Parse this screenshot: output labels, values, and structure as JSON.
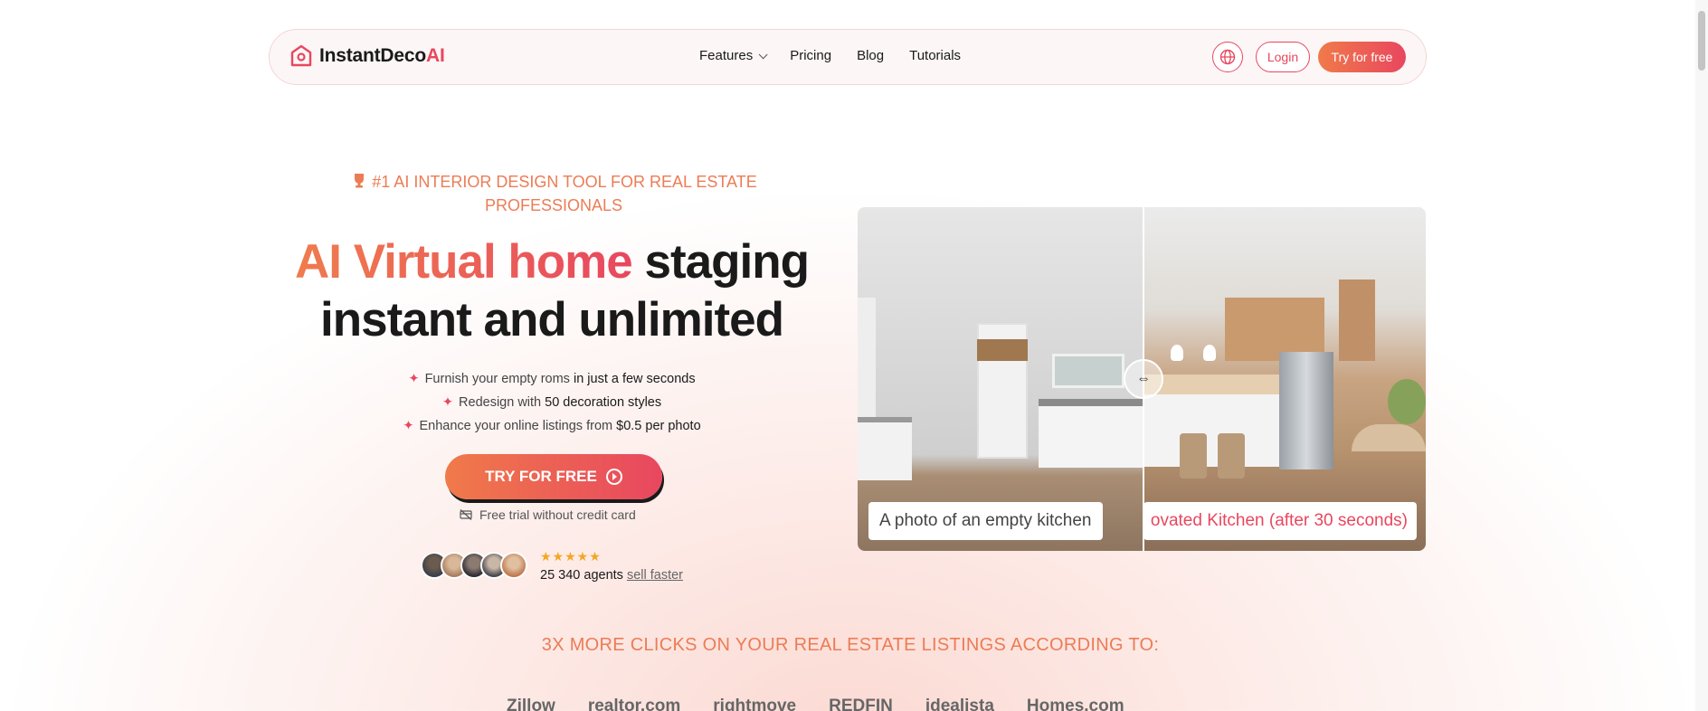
{
  "nav": {
    "brand_main": "InstantDeco",
    "brand_ai": "AI",
    "menu": [
      "Features",
      "Pricing",
      "Blog",
      "Tutorials"
    ],
    "login": "Login",
    "try_free": "Try for free"
  },
  "hero": {
    "tagline": "#1 AI INTERIOR DESIGN TOOL FOR REAL ESTATE PROFESSIONALS",
    "headline_accent": "AI Virtual home",
    "headline_rest_1": " staging",
    "headline_rest_2": "instant and unlimited",
    "bullets": [
      {
        "plain": "Furnish your empty roms ",
        "strong": "in just a few seconds"
      },
      {
        "plain": "Redesign with ",
        "strong": "50 decoration styles"
      },
      {
        "plain": "Enhance your online listings from ",
        "strong": "$0.5 per photo"
      }
    ],
    "cta": "TRY FOR FREE",
    "free_trial": "Free trial without credit card",
    "stars": "★★★★★",
    "agents_text": "25 340 agents ",
    "agents_link": "sell faster"
  },
  "photo": {
    "before_label": "A photo of an empty kitchen",
    "after_label": "ovated Kitchen (after 30 seconds)"
  },
  "section": {
    "clicks_title": "3X MORE CLICKS ON YOUR REAL ESTATE LISTINGS ACCORDING TO:",
    "logos": [
      "Zillow",
      "realtor.com",
      "rightmove",
      "REDFIN",
      "idealista",
      "Homes.com"
    ]
  },
  "colors": {
    "accent": "#e8475f",
    "accent_orange": "#ef7c4e",
    "rating_star": "#f5a623"
  }
}
